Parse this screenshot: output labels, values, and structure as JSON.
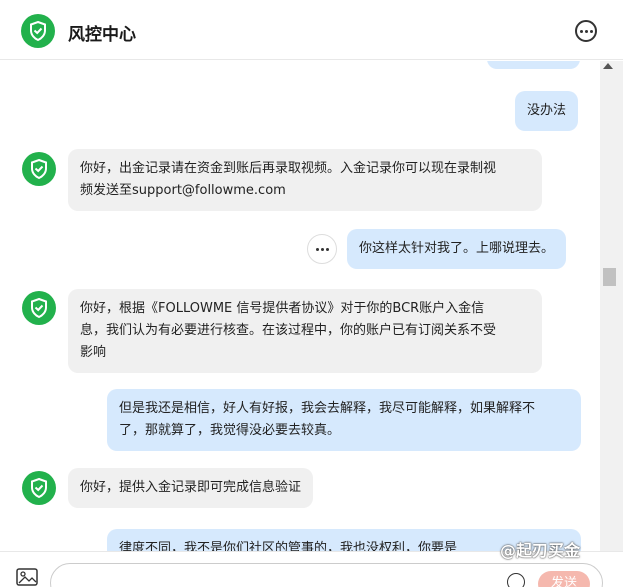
{
  "header": {
    "title": "风控中心",
    "brand_color": "#22b14c",
    "icons": [
      "shield-check-icon",
      "more-circle-icon"
    ]
  },
  "messages": [
    {
      "side": "right",
      "text": ""
    },
    {
      "side": "right",
      "text": "没办法"
    },
    {
      "side": "left",
      "text": "你好，出金记录请在资金到账后再录取视频。入金记录你可以现在录制视\n频发送至support@followme.com"
    },
    {
      "side": "right",
      "text": "你这样太针对我了。上哪说理去。"
    },
    {
      "side": "left",
      "text": "你好，根据《FOLLOWME 信号提供者协议》对于你的BCR账户入金信\n息，我们认为有必要进行核查。在该过程中，你的账户已有订阅关系不受\n影响"
    },
    {
      "side": "right",
      "text": "但是我还是相信，好人有好报，我会去解释，我尽可能解释，如果解释不\n了，那就算了，我觉得没必要去较真。"
    },
    {
      "side": "left",
      "text": "你好，提供入金记录即可完成信息验证"
    },
    {
      "side": "right",
      "text": "律度不同，我不是你们社区的管事的，我也没权利，你要是"
    }
  ],
  "colors": {
    "left_bubble": "#f0f0f0",
    "right_bubble": "#d6e9fd",
    "send_button": "#f5b8ae"
  },
  "footer": {
    "send_label": "发送",
    "icons": [
      "image-icon",
      "emoji-icon"
    ]
  },
  "watermark": "@起刃买金"
}
